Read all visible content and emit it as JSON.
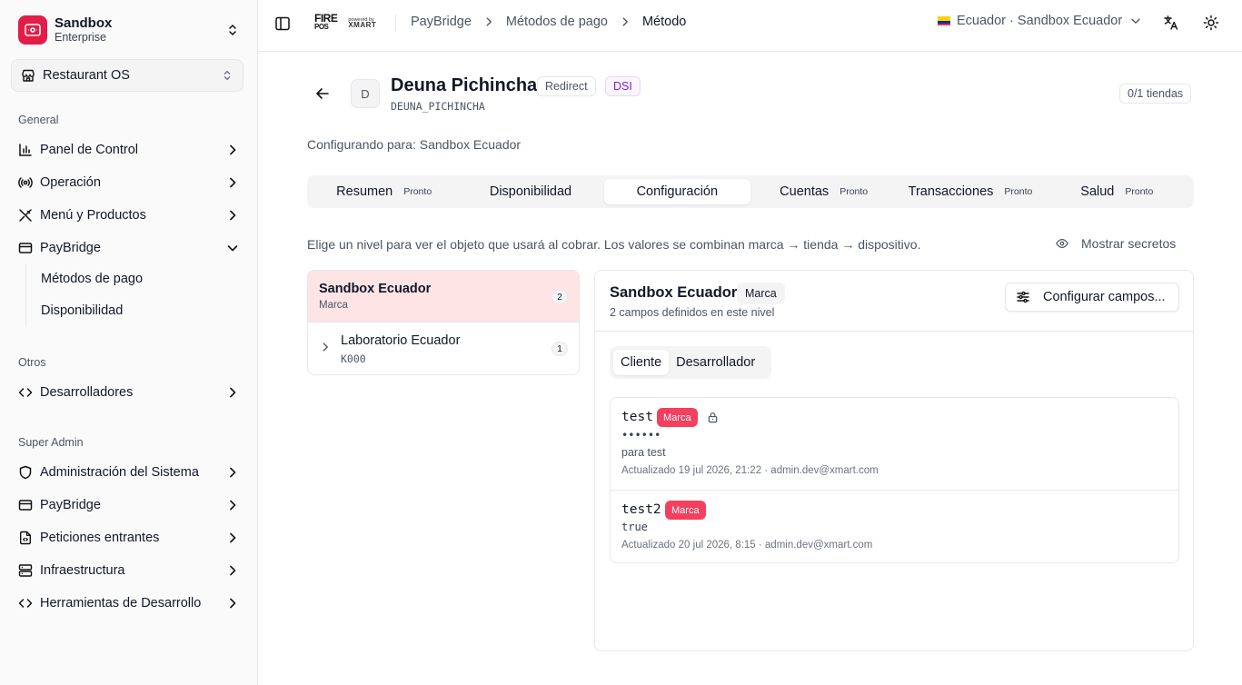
{
  "org": {
    "name": "Sandbox",
    "plan": "Enterprise"
  },
  "workspace": {
    "label": "Restaurant OS"
  },
  "sidebar": {
    "general_label": "General",
    "general": [
      {
        "label": "Panel de Control",
        "icon": "chart-bar-icon"
      },
      {
        "label": "Operación",
        "icon": "broadcast-icon"
      },
      {
        "label": "Menú y Productos",
        "icon": "utensils-icon"
      },
      {
        "label": "PayBridge",
        "icon": "credit-card-icon"
      }
    ],
    "paybridge_sub": [
      {
        "label": "Métodos de pago"
      },
      {
        "label": "Disponibilidad"
      }
    ],
    "otros_label": "Otros",
    "otros": [
      {
        "label": "Desarrolladores",
        "icon": "code-icon"
      }
    ],
    "super_label": "Super Admin",
    "super": [
      {
        "label": "Administración del Sistema",
        "icon": "shield-icon"
      },
      {
        "label": "PayBridge",
        "icon": "credit-card-icon"
      },
      {
        "label": "Peticiones entrantes",
        "icon": "file-code-icon"
      },
      {
        "label": "Infraestructura",
        "icon": "server-icon"
      },
      {
        "label": "Herramientas de Desarrollo",
        "icon": "code-icon"
      }
    ]
  },
  "topbar": {
    "brand_fire": "FIRE",
    "brand_pos": "POS",
    "brand_powered": "powered by",
    "brand_xmart": "XMART",
    "breadcrumbs": [
      "PayBridge",
      "Métodos de pago",
      "Método"
    ],
    "environment": "Ecuador · Sandbox Ecuador",
    "flag_colors": [
      "#FFD100",
      "#0033A0",
      "#EF3340"
    ]
  },
  "method": {
    "avatar": "D",
    "name": "Deuna Pichincha",
    "type_badge": "Redirect",
    "tag_badge": "DSI",
    "code": "DEUNA_PICHINCHA",
    "stores": "0/1 tiendas",
    "configuring_for": "Configurando para: Sandbox Ecuador"
  },
  "tabs": [
    {
      "label": "Resumen",
      "soon": "Pronto"
    },
    {
      "label": "Disponibilidad",
      "soon": ""
    },
    {
      "label": "Configuración",
      "soon": ""
    },
    {
      "label": "Cuentas",
      "soon": "Pronto"
    },
    {
      "label": "Transacciones",
      "soon": "Pronto"
    },
    {
      "label": "Salud",
      "soon": "Pronto"
    }
  ],
  "active_tab": "Configuración",
  "hint": "Elige un nivel para ver el objeto que usará al cobrar. Los valores se combinan marca → tienda → dispositivo.",
  "show_secrets": "Mostrar secretos",
  "levels": [
    {
      "name": "Sandbox Ecuador",
      "sub": "Marca",
      "count": "2"
    },
    {
      "name": "Laboratorio Ecuador",
      "sub": "K000",
      "count": "1"
    }
  ],
  "panel": {
    "title": "Sandbox Ecuador",
    "badge": "Marca",
    "subtitle": "2 campos definidos en este nivel",
    "configure_button": "Configurar campos...",
    "segments": [
      "Cliente",
      "Desarrollador"
    ],
    "fields": [
      {
        "key": "test",
        "badge": "Marca",
        "value": "••••••",
        "description": "para test",
        "meta": "Actualizado 19 jul 2026, 21:22 · admin.dev@xmart.com"
      },
      {
        "key": "test2",
        "badge": "Marca",
        "value": "true",
        "meta": "Actualizado 20 jul 2026, 8:15 · admin.dev@xmart.com"
      }
    ]
  },
  "colors": {
    "accent": "#e11d48",
    "selected_level": "#ffe4e6",
    "brand_badge": "#f43f5e",
    "dsi": "#7e22ce"
  }
}
